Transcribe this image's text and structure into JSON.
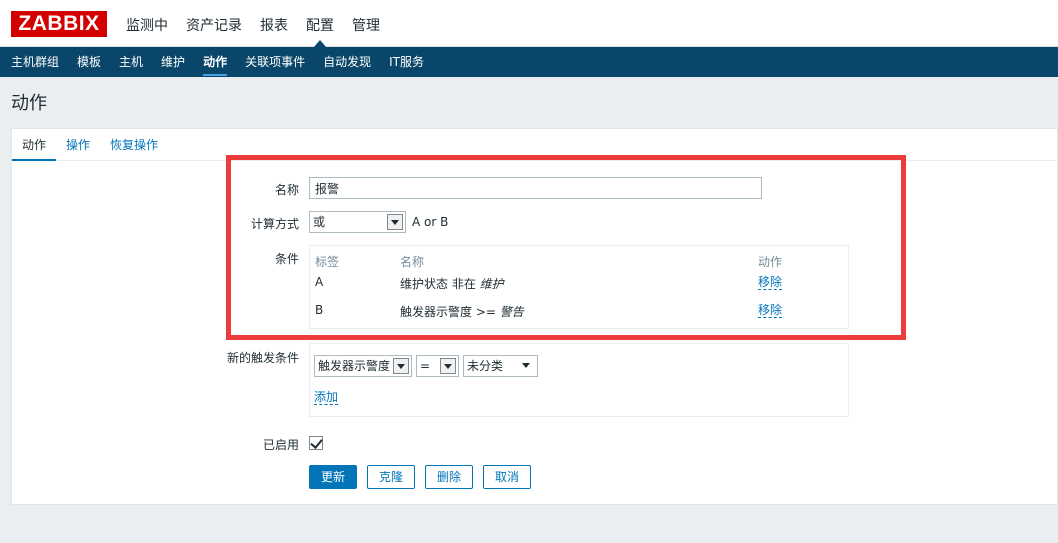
{
  "brand": {
    "logo_text": "ZABBIX",
    "logo_color": "#d40000"
  },
  "main_menu": [
    {
      "label": "监测中"
    },
    {
      "label": "资产记录"
    },
    {
      "label": "报表"
    },
    {
      "label": "配置",
      "active": true
    },
    {
      "label": "管理"
    }
  ],
  "sub_nav": [
    {
      "label": "主机群组"
    },
    {
      "label": "模板"
    },
    {
      "label": "主机"
    },
    {
      "label": "维护"
    },
    {
      "label": "动作",
      "active": true
    },
    {
      "label": "关联项事件"
    },
    {
      "label": "自动发现"
    },
    {
      "label": "IT服务"
    }
  ],
  "page": {
    "title": "动作"
  },
  "tabs": [
    {
      "label": "动作",
      "active": true
    },
    {
      "label": "操作"
    },
    {
      "label": "恢复操作"
    }
  ],
  "form": {
    "name_label": "名称",
    "name_value": "报警",
    "calc_label": "计算方式",
    "calc_value": "或",
    "calc_formula": "A or B",
    "conditions_label": "条件",
    "conditions_headers": {
      "tag": "标签",
      "name": "名称",
      "action": "动作"
    },
    "conditions": [
      {
        "tag": "A",
        "name_prefix": "维护状态 非在 ",
        "name_value": "维护",
        "action": "移除"
      },
      {
        "tag": "B",
        "name_prefix": "触发器示警度 >= ",
        "name_value": "警告",
        "action": "移除"
      }
    ],
    "new_condition_label": "新的触发条件",
    "new_condition_type": "触发器示警度",
    "new_condition_operator": "=",
    "new_condition_value": "未分类",
    "add_link": "添加",
    "enabled_label": "已启用",
    "enabled": true
  },
  "buttons": {
    "update": "更新",
    "clone": "克隆",
    "delete": "删除",
    "cancel": "取消"
  },
  "colors": {
    "nav_bg": "#0a466a",
    "link": "#0275b8",
    "highlight_box": "#ee3b3b"
  }
}
